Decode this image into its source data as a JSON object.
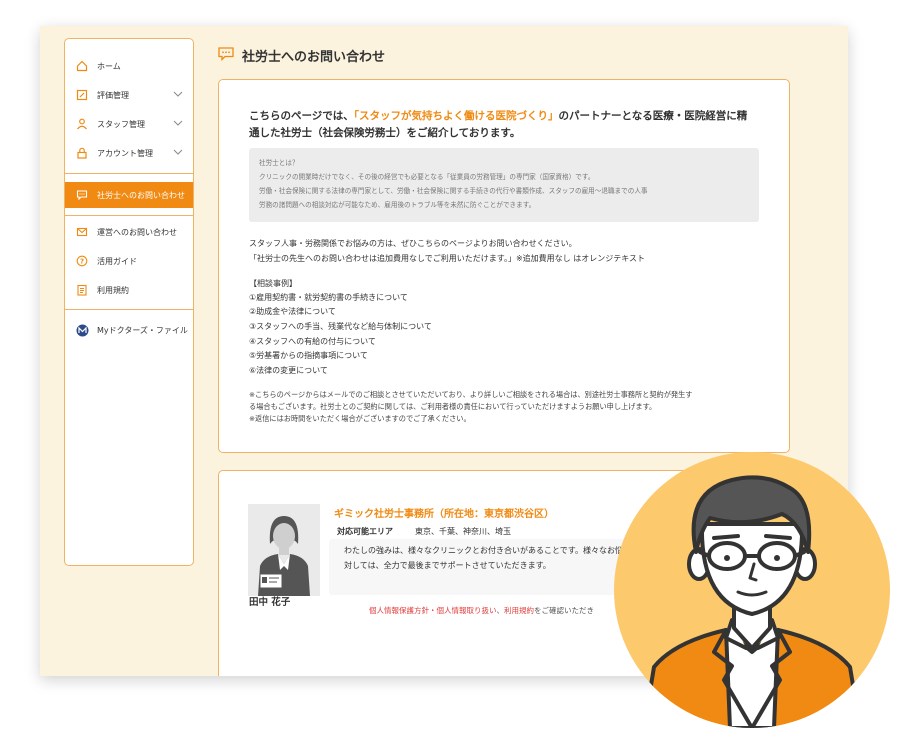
{
  "sidebar": {
    "items": [
      {
        "label": "ホーム",
        "icon": "home-icon"
      },
      {
        "label": "評価管理",
        "icon": "evaluation-icon",
        "expandable": true
      },
      {
        "label": "スタッフ管理",
        "icon": "person-icon",
        "expandable": true
      },
      {
        "label": "アカウント管理",
        "icon": "lock-icon",
        "expandable": true
      },
      {
        "label": "社労士へのお問い合わせ",
        "icon": "chat-icon",
        "active": true
      },
      {
        "label": "運営へのお問い合わせ",
        "icon": "mail-icon"
      },
      {
        "label": "活用ガイド",
        "icon": "question-icon"
      },
      {
        "label": "利用規約",
        "icon": "document-icon"
      },
      {
        "label": "Myドクターズ・ファイル",
        "icon": "logo-icon"
      }
    ]
  },
  "page": {
    "title": "社労士へのお問い合わせ"
  },
  "intro": {
    "pre": "こちらのページでは、",
    "highlight": "「スタッフが気持ちよく働ける医院づくり」",
    "post": "のパートナーとなる医療・医院経営に精",
    "line2": "通した社労士（社会保険労務士）をご紹介しております。"
  },
  "about": {
    "lines": [
      "社労士とは？",
      "クリニックの開業時だけでなく、その後の経営でも必要となる「従業員の労務管理」の専門家（国家資格）です。",
      "労働・社会保険に関する法律の専門家として、労働・社会保険に関する手続きの代行や書類作成、スタッフの雇用〜退職までの人事",
      "労務の諸問題への相談対応が可能なため、雇用後のトラブル等を未然に防ぐことができます。"
    ]
  },
  "body": {
    "lines": [
      "スタッフ人事・労務関係でお悩みの方は、ぜひこちらのページよりお問い合わせください。",
      "「社労士の先生へのお問い合わせは追加費用なしでご利用いただけます。」※追加費用なし はオレンジテキスト"
    ]
  },
  "cases": {
    "heading": "【相談事例】",
    "items": [
      "①雇用契約書・就労契約書の手続きについて",
      "②助成金や法律について",
      "③スタッフへの手当、残業代など給与体制について",
      "④スタッフへの有給の付与について",
      "⑤労基署からの指摘事項について",
      "⑥法律の変更について"
    ]
  },
  "notes": {
    "lines": [
      "※こちらのページからはメールでのご相談とさせていただいており、より詳しいご相談をされる場合は、別途社労士事務所と契約が発生す",
      "る場合もございます。社労士とのご契約に関しては、ご利用者様の責任において行っていただけますようお願い申し上げます。",
      "※返信にはお時間をいただく場合がございますのでご了承ください。"
    ]
  },
  "office": {
    "name": "ギミック社労士事務所（所在地：東京都渋谷区）",
    "area_label": "対応可能エリア",
    "area_value": "東京、千葉、神奈川、埼玉",
    "message_lines": [
      "わたしの強みは、様々なクリニックとお付き合いがあることです。様々なお悩みに",
      "対しては、全力で最後までサポートさせていただきます。"
    ],
    "staff_name": "田中 花子",
    "consent_link1": "個人情報保護方針・個人情報取り扱い",
    "consent_sep": "、",
    "consent_link2": "利用規約",
    "consent_post": "をご確認いただき"
  },
  "colors": {
    "accent": "#f08a12",
    "page_bg": "#fcf3df",
    "border": "#f0b366",
    "illustration_bg": "#fcc96c"
  }
}
